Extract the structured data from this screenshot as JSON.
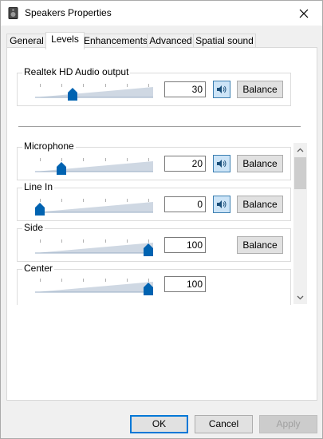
{
  "window": {
    "title": "Speakers Properties",
    "close_icon": "close-icon",
    "app_icon": "speaker-device-icon"
  },
  "tabs": [
    {
      "label": "General",
      "active": false
    },
    {
      "label": "Levels",
      "active": true
    },
    {
      "label": "Enhancements",
      "active": false
    },
    {
      "label": "Advanced",
      "active": false
    },
    {
      "label": "Spatial sound",
      "active": false
    }
  ],
  "master": {
    "label": "Realtek HD Audio output",
    "value": "30",
    "level": 30,
    "mute_icon": "speaker-icon",
    "balance_label": "Balance"
  },
  "channels": [
    {
      "label": "Microphone",
      "value": "20",
      "level": 20,
      "has_mute": true,
      "has_balance": true,
      "balance_label": "Balance"
    },
    {
      "label": "Line In",
      "value": "0",
      "level": 0,
      "has_mute": true,
      "has_balance": true,
      "balance_label": "Balance"
    },
    {
      "label": "Side",
      "value": "100",
      "level": 100,
      "has_mute": false,
      "has_balance": true,
      "balance_label": "Balance"
    },
    {
      "label": "Center",
      "value": "100",
      "level": 100,
      "has_mute": false,
      "has_balance": false
    }
  ],
  "footer": {
    "ok_label": "OK",
    "cancel_label": "Cancel",
    "apply_label": "Apply"
  },
  "colors": {
    "accent": "#0078d7",
    "thumb": "#0063b1",
    "track": "#cfd8e3"
  }
}
